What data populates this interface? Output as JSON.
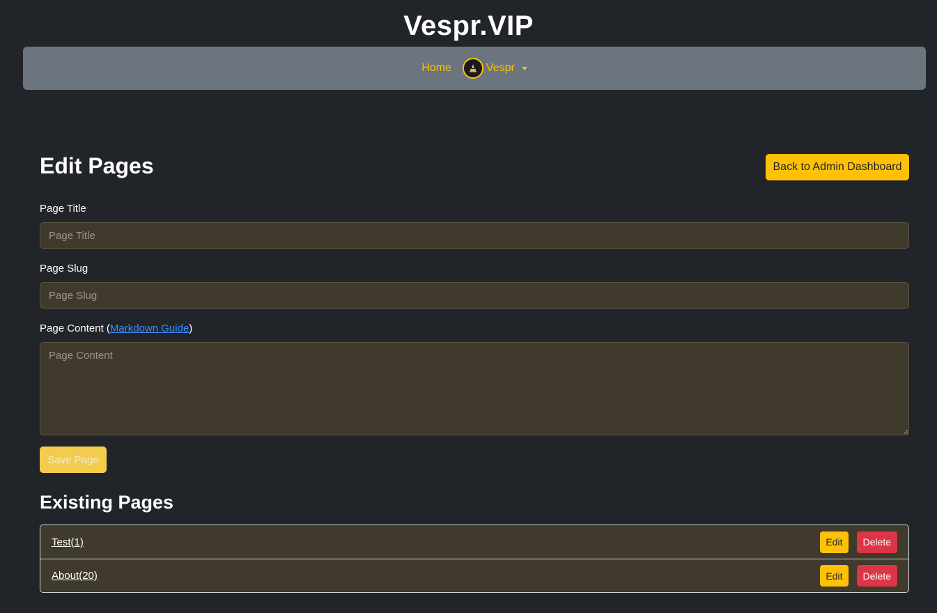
{
  "site": {
    "title": "Vespr.VIP"
  },
  "navbar": {
    "home_label": "Home",
    "user_name": "Vespr",
    "avatar_icon": "candle-logo-icon"
  },
  "header": {
    "title": "Edit Pages",
    "back_button_label": "Back to Admin Dashboard"
  },
  "form": {
    "title_label": "Page Title",
    "title_placeholder": "Page Title",
    "title_value": "",
    "slug_label": "Page Slug",
    "slug_placeholder": "Page Slug",
    "slug_value": "",
    "content_label": "Page Content (",
    "content_guide_link": "Markdown Guide",
    "content_label_close": ")",
    "content_placeholder": "Page Content",
    "content_value": "",
    "save_label": "Save Page"
  },
  "existing": {
    "title": "Existing Pages",
    "pages": [
      {
        "name": "Test(1)",
        "edit_label": "Edit",
        "delete_label": "Delete"
      },
      {
        "name": "About(20)",
        "edit_label": "Edit",
        "delete_label": "Delete"
      }
    ]
  },
  "colors": {
    "background": "#212529",
    "navbar": "#6c757d",
    "accent": "#ffc107",
    "danger": "#dc3545",
    "field_bg": "#3f3a2c",
    "link": "#3d8bfd"
  }
}
